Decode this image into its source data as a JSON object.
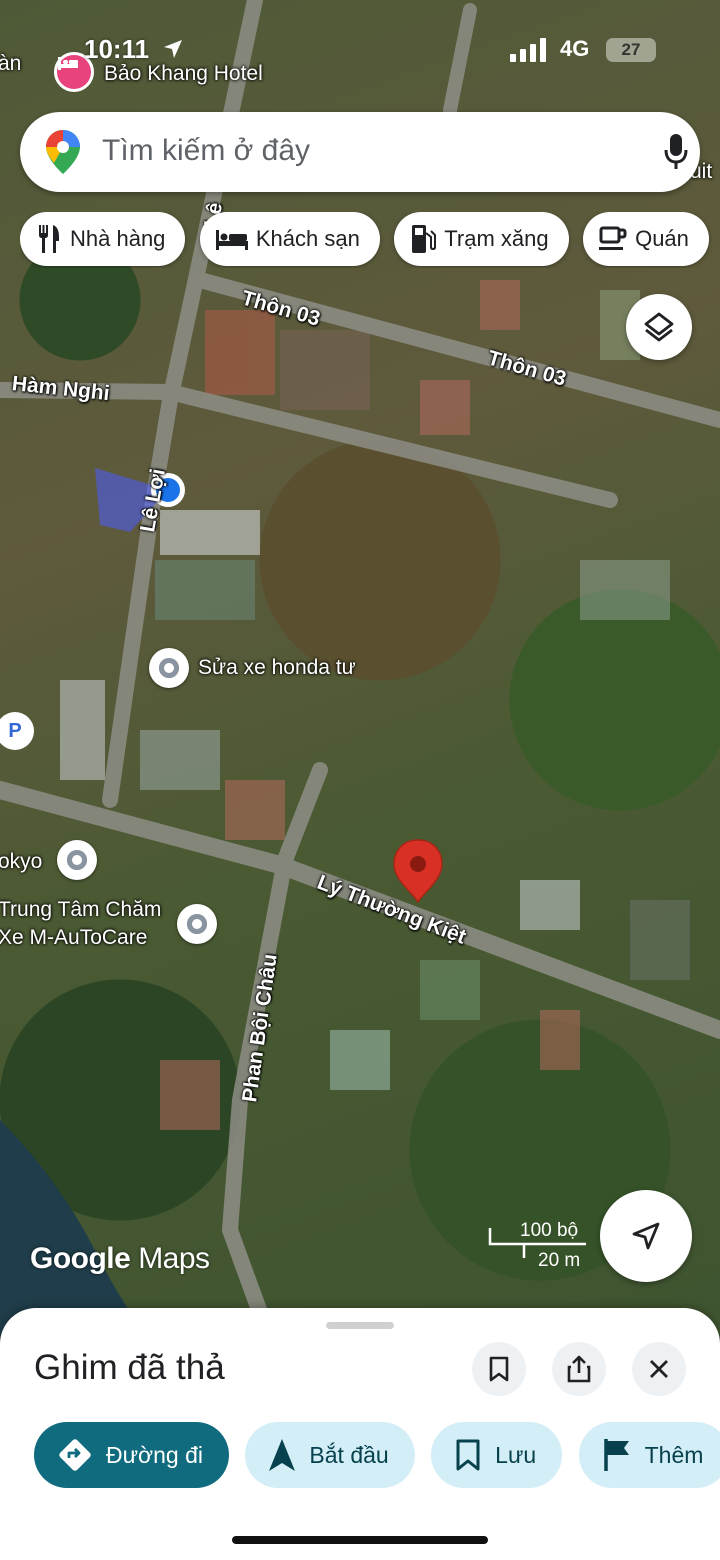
{
  "status_bar": {
    "time": "10:11",
    "network": "4G",
    "battery": "27"
  },
  "search": {
    "placeholder": "Tìm kiếm ở đây"
  },
  "chips": [
    {
      "label": "Nhà hàng",
      "icon": "restaurant-icon"
    },
    {
      "label": "Khách sạn",
      "icon": "hotel-icon"
    },
    {
      "label": "Trạm xăng",
      "icon": "gas-station-icon"
    },
    {
      "label": "Quán",
      "icon": "cafe-icon"
    }
  ],
  "map": {
    "top_left_fragment": "àn",
    "hotel_name": "Bảo Khang Hotel",
    "right_fragment": "uit",
    "roads": {
      "thon_03_a": "Thôn 03",
      "thon_03_b": "Thôn 03",
      "ham_nghi": "Hàm Nghi",
      "le_loi": "Lê Lợi",
      "le_top": "Lê",
      "ly_thuong_kiet": "Lý Thường Kiệt",
      "phan_boi_chau": "Phan Bội Châu",
      "ph_fragment": "Ph"
    },
    "pois": {
      "sua_xe": "Sửa xe honda tư",
      "tokyo": "okyo",
      "autocare_line1": "Trung Tâm Chăm",
      "autocare_line2": "Xe M-AuToCare",
      "parking": "P"
    },
    "scale_feet": "100 bộ",
    "scale_meters": "20 m",
    "logo_google": "Google",
    "logo_maps": "Maps",
    "colors": {
      "pin": "#d93025",
      "location_dot": "#1a73e8"
    }
  },
  "sheet": {
    "title": "Ghim đã thả",
    "actions": [
      {
        "label": "Đường đi",
        "icon": "directions-icon"
      },
      {
        "label": "Bắt đầu",
        "icon": "navigation-icon"
      },
      {
        "label": "Lưu",
        "icon": "bookmark-icon"
      },
      {
        "label": "Thêm",
        "icon": "flag-icon"
      }
    ],
    "colors": {
      "primary": "#0f6b7d",
      "secondary": "#d3eef7"
    }
  }
}
